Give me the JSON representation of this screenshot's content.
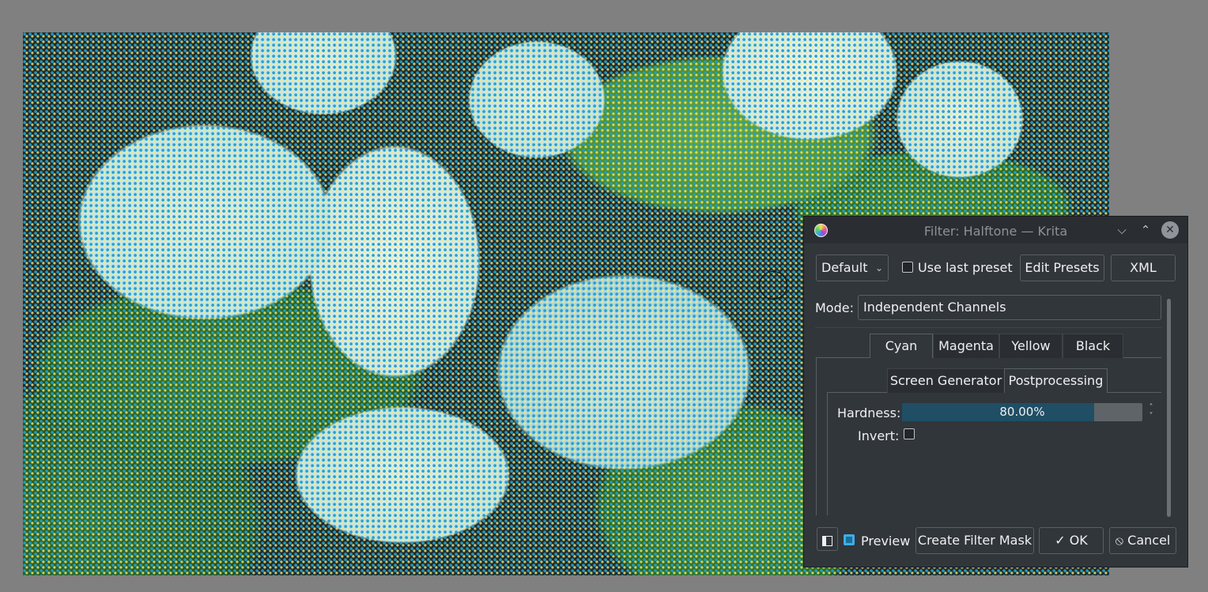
{
  "canvas": {
    "image_description_icon": "halftone-artwork"
  },
  "dialog": {
    "title": "Filter: Halftone — Krita",
    "window_buttons": {
      "minimize": "⌵",
      "maximize": "⌃",
      "close": "✕"
    },
    "preset": {
      "selected": "Default",
      "use_last_preset_label": "Use last preset",
      "edit_presets_label": "Edit Presets",
      "xml_label": "XML"
    },
    "mode": {
      "label": "Mode:",
      "value": "Independent Channels"
    },
    "channel_tabs": [
      "Cyan",
      "Magenta",
      "Yellow",
      "Black"
    ],
    "active_channel_tab": "Cyan",
    "sub_tabs": [
      "Screen Generator",
      "Postprocessing"
    ],
    "active_sub_tab": "Postprocessing",
    "postprocessing": {
      "hardness_label": "Hardness:",
      "hardness_value": "80.00%",
      "hardness_fraction": 0.8,
      "invert_label": "Invert:",
      "invert_checked": false
    },
    "footer": {
      "preview_label": "Preview",
      "preview_checked": true,
      "create_filter_mask_label": "Create Filter Mask",
      "ok_label": "OK",
      "ok_icon": "✓",
      "cancel_label": "Cancel",
      "cancel_icon": "⦸"
    }
  },
  "colors": {
    "dialog_bg": "#31363b",
    "accent": "#3daee9",
    "slider_fill": "#1f4e65"
  }
}
